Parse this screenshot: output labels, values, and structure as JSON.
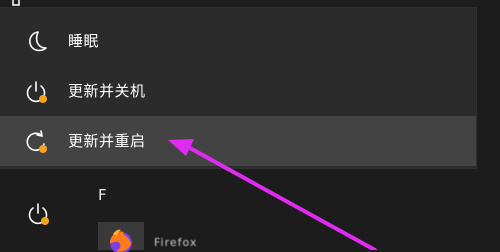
{
  "power_menu": {
    "items": [
      {
        "label": "睡眠",
        "icon": "moon-icon"
      },
      {
        "label": "更新并关机",
        "icon": "power-update-icon"
      },
      {
        "label": "更新并重启",
        "icon": "restart-update-icon",
        "highlighted": true
      }
    ]
  },
  "app_list": {
    "section_letter": "F",
    "app_name_partial": "Firefox"
  },
  "colors": {
    "menu_bg": "#2b2b2b",
    "highlight_bg": "#434343",
    "update_badge": "#f7a21b",
    "annotation_arrow": "#e02cf0"
  }
}
